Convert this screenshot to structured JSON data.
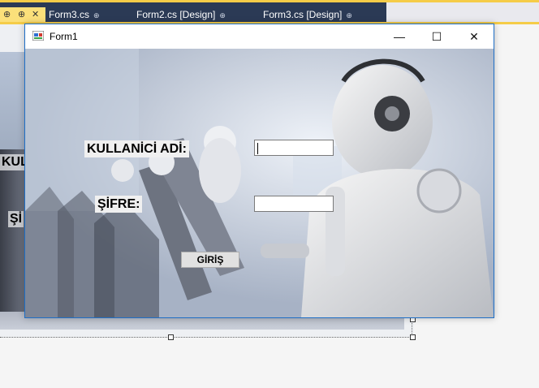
{
  "ide": {
    "tabs": [
      {
        "label": "Form3.cs",
        "pin": "⊕"
      },
      {
        "label": "Form2.cs [Design]",
        "pin": "⊕"
      },
      {
        "label": "Form3.cs [Design]",
        "pin": "⊕"
      }
    ],
    "active_tab_icons": {
      "pin": "⊕",
      "close": "✕"
    }
  },
  "background_form": {
    "label_username_partial": "KUL",
    "label_password_partial": "Şİ"
  },
  "window": {
    "title": "Form1",
    "minimize": "—",
    "maximize": "☐",
    "close": "✕"
  },
  "form": {
    "username_label": "KULLANİCİ ADİ:",
    "password_label": "ŞİFRE:",
    "username_value": "",
    "password_value": "",
    "login_button": "GİRİŞ"
  },
  "colors": {
    "ide_bar": "#2b3a55",
    "ide_accent": "#f5cc48",
    "window_border": "#1f6fc6"
  },
  "icons": [
    "pin-icon",
    "close-icon",
    "app-icon",
    "minimize-icon",
    "maximize-icon"
  ]
}
